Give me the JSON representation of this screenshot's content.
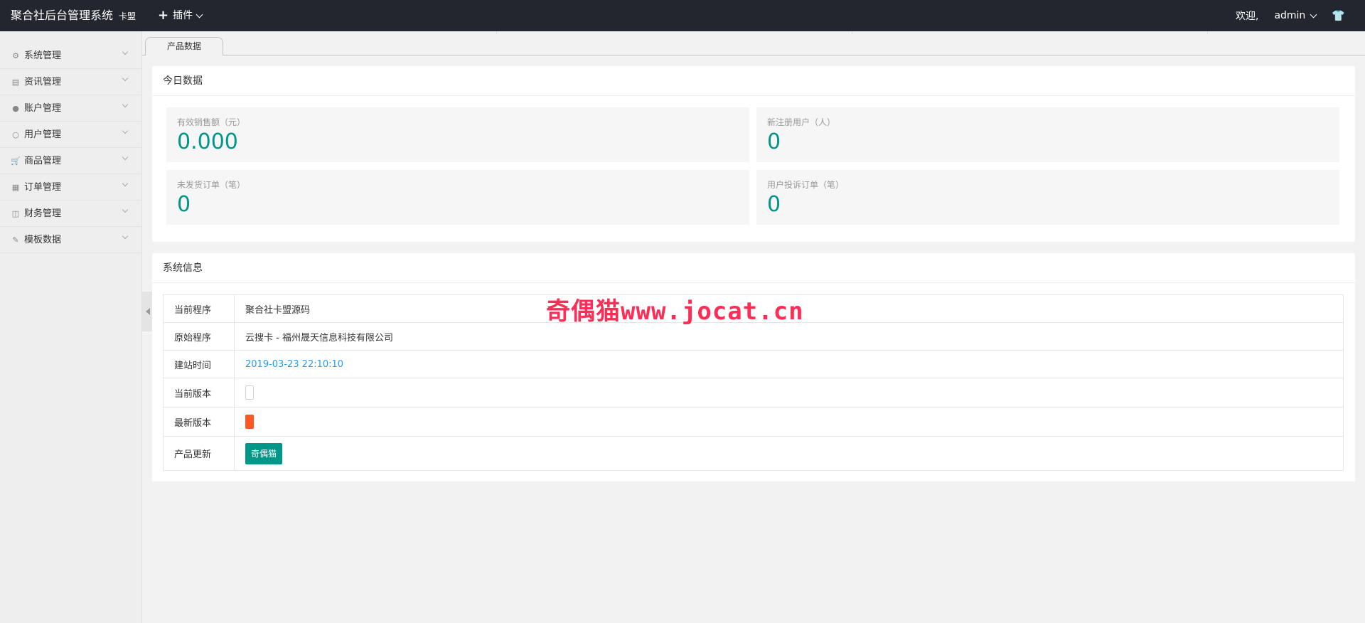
{
  "header": {
    "title": "聚合社后台管理系统",
    "subtitle": "卡盟",
    "plugin_label": "插件",
    "welcome": "欢迎,",
    "user": "admin"
  },
  "sidebar": {
    "items": [
      {
        "label": "系统管理",
        "icon": "gear-icon"
      },
      {
        "label": "资讯管理",
        "icon": "news-icon"
      },
      {
        "label": "账户管理",
        "icon": "user-icon"
      },
      {
        "label": "用户管理",
        "icon": "user-outline-icon"
      },
      {
        "label": "商品管理",
        "icon": "cart-icon"
      },
      {
        "label": "订单管理",
        "icon": "clipboard-icon"
      },
      {
        "label": "财务管理",
        "icon": "wallet-icon"
      },
      {
        "label": "模板数据",
        "icon": "edit-icon"
      }
    ]
  },
  "tabs": {
    "active": "产品数据"
  },
  "today": {
    "title": "今日数据",
    "stats": [
      {
        "label": "有效销售额（元）",
        "value": "0.000"
      },
      {
        "label": "新注册用户（人）",
        "value": "0"
      },
      {
        "label": "未发货订单（笔）",
        "value": "0"
      },
      {
        "label": "用户投诉订单（笔）",
        "value": "0"
      }
    ]
  },
  "sysinfo": {
    "title": "系统信息",
    "rows": [
      {
        "key": "当前程序",
        "value": "聚合社卡盟源码"
      },
      {
        "key": "原始程序",
        "value": "云搜卡 - 福州晟天信息科技有限公司"
      },
      {
        "key": "建站时间",
        "value": "2019-03-23 22:10:10"
      },
      {
        "key": "当前版本",
        "value": ""
      },
      {
        "key": "最新版本",
        "value": ""
      },
      {
        "key": "产品更新",
        "button": "奇偶猫"
      }
    ]
  },
  "watermark": "奇偶猫www.jocat.cn",
  "colors": {
    "header_bg": "#23262e",
    "accent": "#009688",
    "link": "#1e9fff",
    "latest_version": "#ff5722",
    "watermark": "#ff2d55"
  }
}
